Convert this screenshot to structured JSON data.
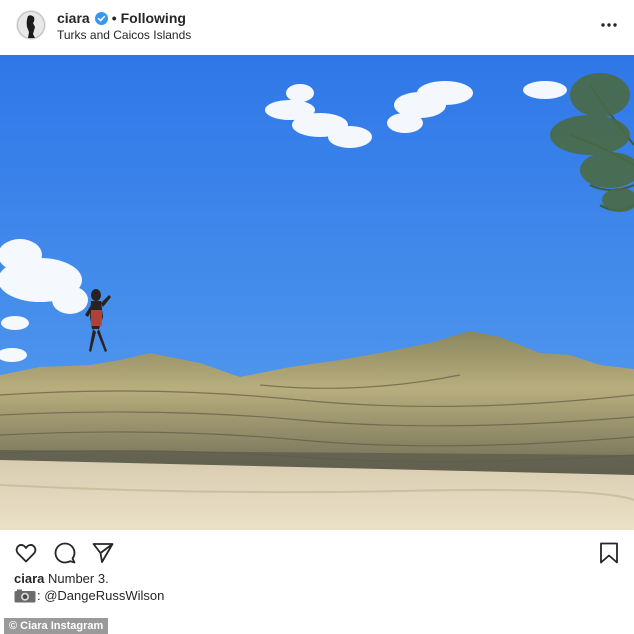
{
  "post": {
    "username": "ciara",
    "separator": "•",
    "follow_label": "Following",
    "location": "Turks and Caicos Islands",
    "more_icon": "more-horizontal-icon"
  },
  "actions": {
    "like_icon": "heart-icon",
    "comment_icon": "comment-icon",
    "share_icon": "send-icon",
    "save_icon": "bookmark-icon"
  },
  "caption": {
    "username": "ciara",
    "text": "Number 3.",
    "photo_credit": ": @DangeRussWilson"
  },
  "watermark": "© Ciara Instagram",
  "colors": {
    "sky_top": "#2f77e8",
    "sky_bottom": "#5aa3ec",
    "verified_badge": "#3897f0",
    "sand": "#e4d8bb",
    "rock": "#a9a177"
  }
}
